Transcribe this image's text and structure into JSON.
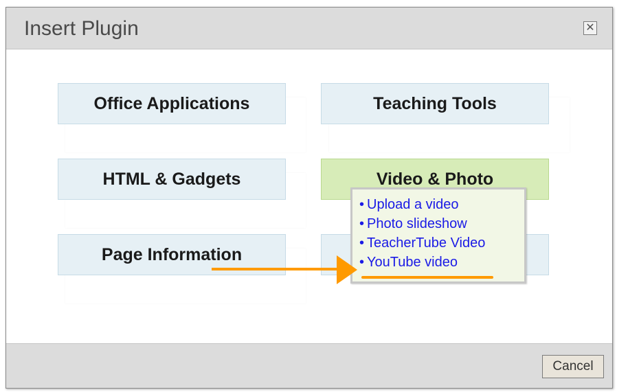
{
  "dialog": {
    "title": "Insert Plugin",
    "close_icon": "close-icon"
  },
  "plugins": [
    {
      "label": "Office Applications"
    },
    {
      "label": "Teaching Tools"
    },
    {
      "label": "HTML & Gadgets"
    },
    {
      "label": "Video & Photo"
    },
    {
      "label": "Page Information"
    }
  ],
  "video_menu": {
    "items": [
      {
        "label": "Upload a video"
      },
      {
        "label": "Photo slideshow"
      },
      {
        "label": "TeacherTube Video"
      },
      {
        "label": "YouTube video"
      }
    ]
  },
  "footer": {
    "cancel_label": "Cancel"
  },
  "colors": {
    "accent_arrow": "#ff9a00",
    "active_button": "#d7ecb8",
    "button": "#e6f0f5",
    "link": "#1a1ae6"
  }
}
